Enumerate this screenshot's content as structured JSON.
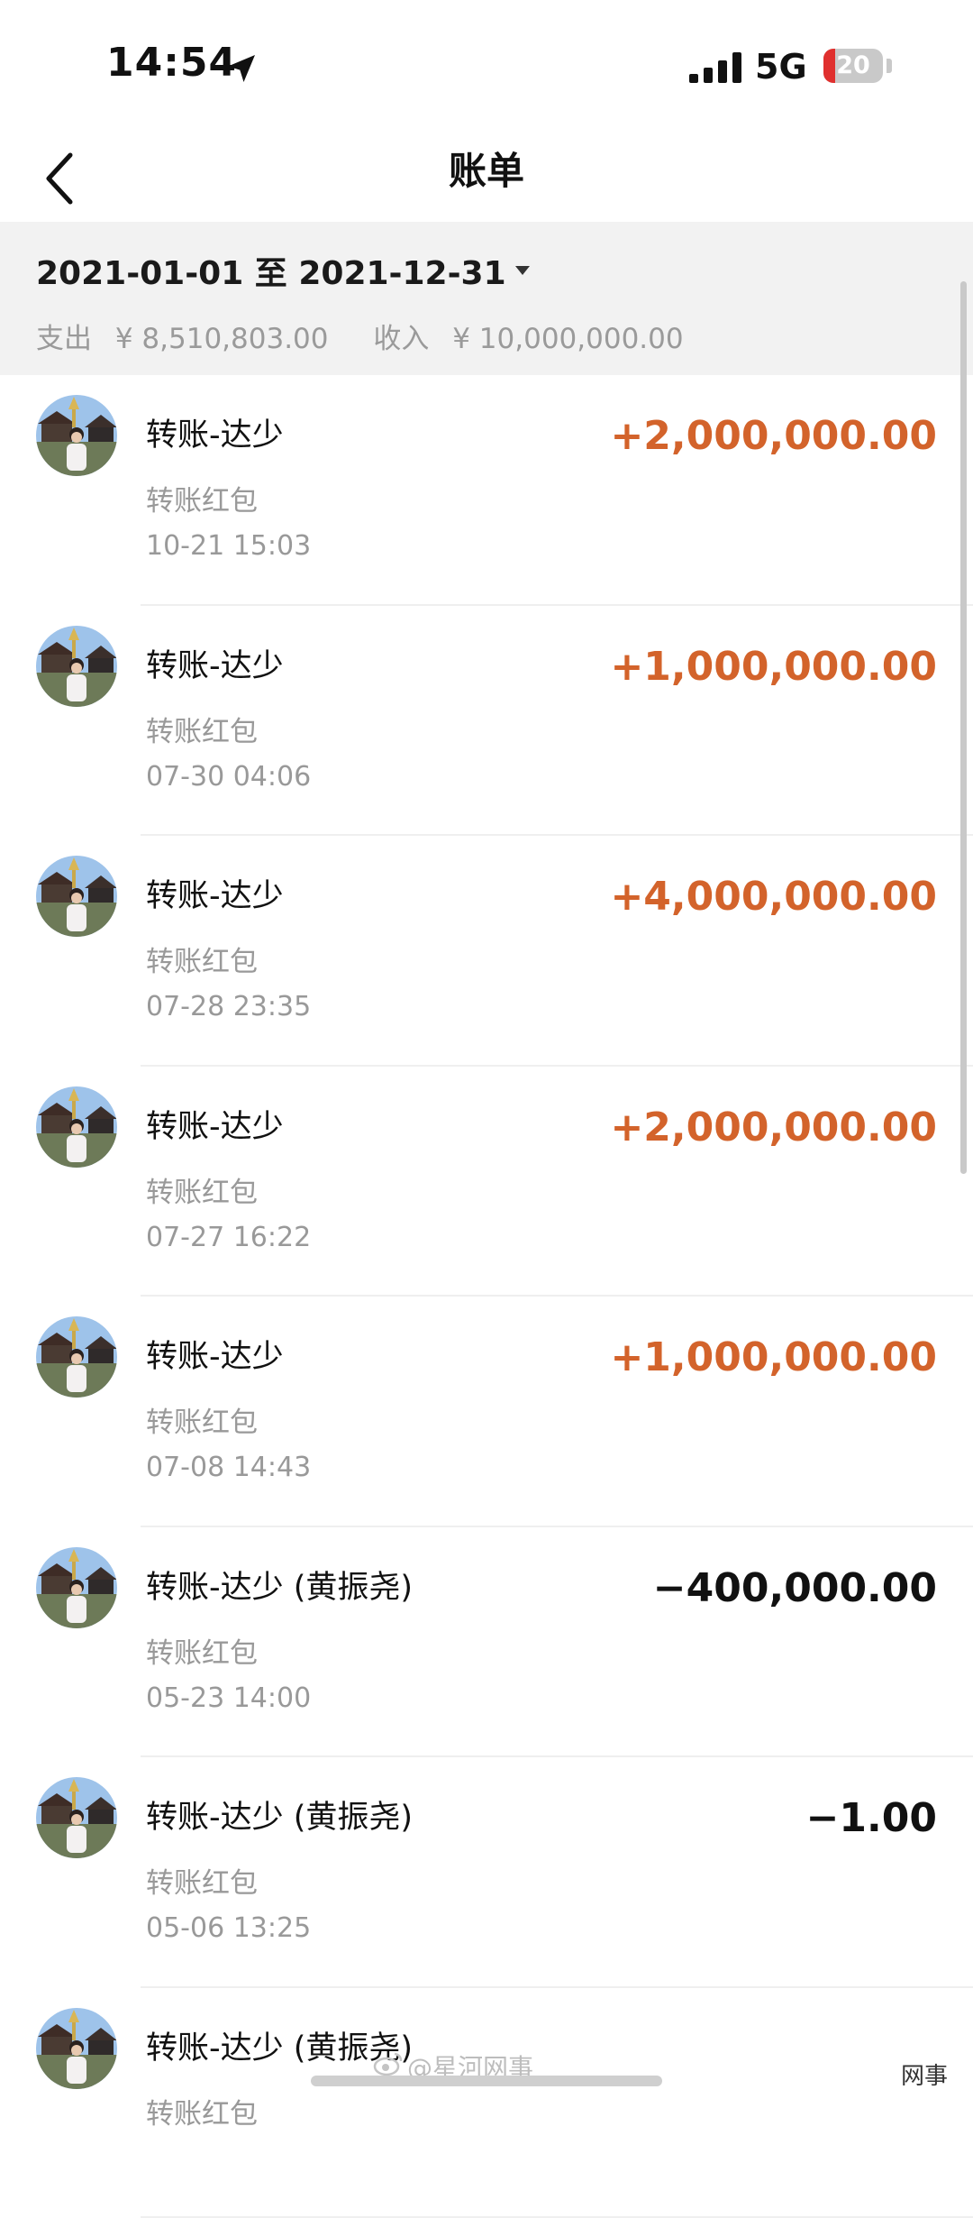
{
  "status_bar": {
    "time": "14:54",
    "network": "5G",
    "battery": "20",
    "battery_level": 0.2
  },
  "nav": {
    "title": "账单"
  },
  "filter": {
    "range": "2021-01-01 至 2021-12-31",
    "expense_label": "支出",
    "expense_value": "¥ 8,510,803.00",
    "income_label": "收入",
    "income_value": "¥ 10,000,000.00"
  },
  "transactions": [
    {
      "name": "转账-达少",
      "type": "转账红包",
      "date": "10-21  15:03",
      "amount": "+2,000,000.00",
      "direction": "in"
    },
    {
      "name": "转账-达少",
      "type": "转账红包",
      "date": "07-30  04:06",
      "amount": "+1,000,000.00",
      "direction": "in"
    },
    {
      "name": "转账-达少",
      "type": "转账红包",
      "date": "07-28  23:35",
      "amount": "+4,000,000.00",
      "direction": "in"
    },
    {
      "name": "转账-达少",
      "type": "转账红包",
      "date": "07-27  16:22",
      "amount": "+2,000,000.00",
      "direction": "in"
    },
    {
      "name": "转账-达少",
      "type": "转账红包",
      "date": "07-08  14:43",
      "amount": "+1,000,000.00",
      "direction": "in"
    },
    {
      "name": "转账-达少 (黄振尧)",
      "type": "转账红包",
      "date": "05-23  14:00",
      "amount": "−400,000.00",
      "direction": "out"
    },
    {
      "name": "转账-达少 (黄振尧)",
      "type": "转账红包",
      "date": "05-06  13:25",
      "amount": "−1.00",
      "direction": "out"
    },
    {
      "name": "转账-达少 (黄振尧)",
      "type": "转账红包",
      "date": "",
      "amount": "",
      "direction": "out"
    }
  ],
  "watermark": {
    "text": "@星河网事",
    "corner": "网事"
  },
  "colors": {
    "income": "#d3632b",
    "expense": "#111111",
    "filter_bg": "#f2f2f2"
  },
  "icons": {
    "back": "chevron-left-icon",
    "location": "location-arrow-icon",
    "signal": "cellular-signal-icon",
    "caret": "caret-down-icon"
  }
}
